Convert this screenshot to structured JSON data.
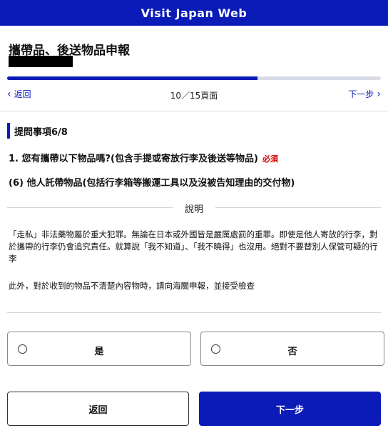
{
  "header": {
    "title": "Visit Japan Web"
  },
  "page": {
    "title": "攜帶品、後送物品申報"
  },
  "progress": {
    "current": 10,
    "total": 15,
    "fraction": 0.67
  },
  "nav": {
    "back_label": "返回",
    "page_indicator": "10／15頁面",
    "next_label": "下一步"
  },
  "section": {
    "tag": "提問事項6/8"
  },
  "question": {
    "text": "1. 您有攜帶以下物品嗎?(包含手提或寄放行李及後送等物品)",
    "required_label": "必須"
  },
  "sub_item": {
    "text": "(6) 他人託帶物品(包括行李箱等搬運工具以及沒被告知理由的交付物)"
  },
  "explanation": {
    "label": "說明",
    "paragraph1": "「走私」非法藥物屬於重大犯罪。無論在日本或外國皆是嚴厲處罰的重罪。即使是他人寄放的行李，對於攜帶的行李仍會追究責任。就算說「我不知道」、「我不曉得」也沒用。絕對不要替別人保管可疑的行李",
    "paragraph2": "此外，對於收到的物品不清楚內容物時，請向海關申報，並接受檢查"
  },
  "options": [
    {
      "label": "是"
    },
    {
      "label": "否"
    }
  ],
  "buttons": {
    "back_label": "返回",
    "next_label": "下一步"
  },
  "colors": {
    "brand": "#0a1bb8",
    "required": "#d40000"
  }
}
